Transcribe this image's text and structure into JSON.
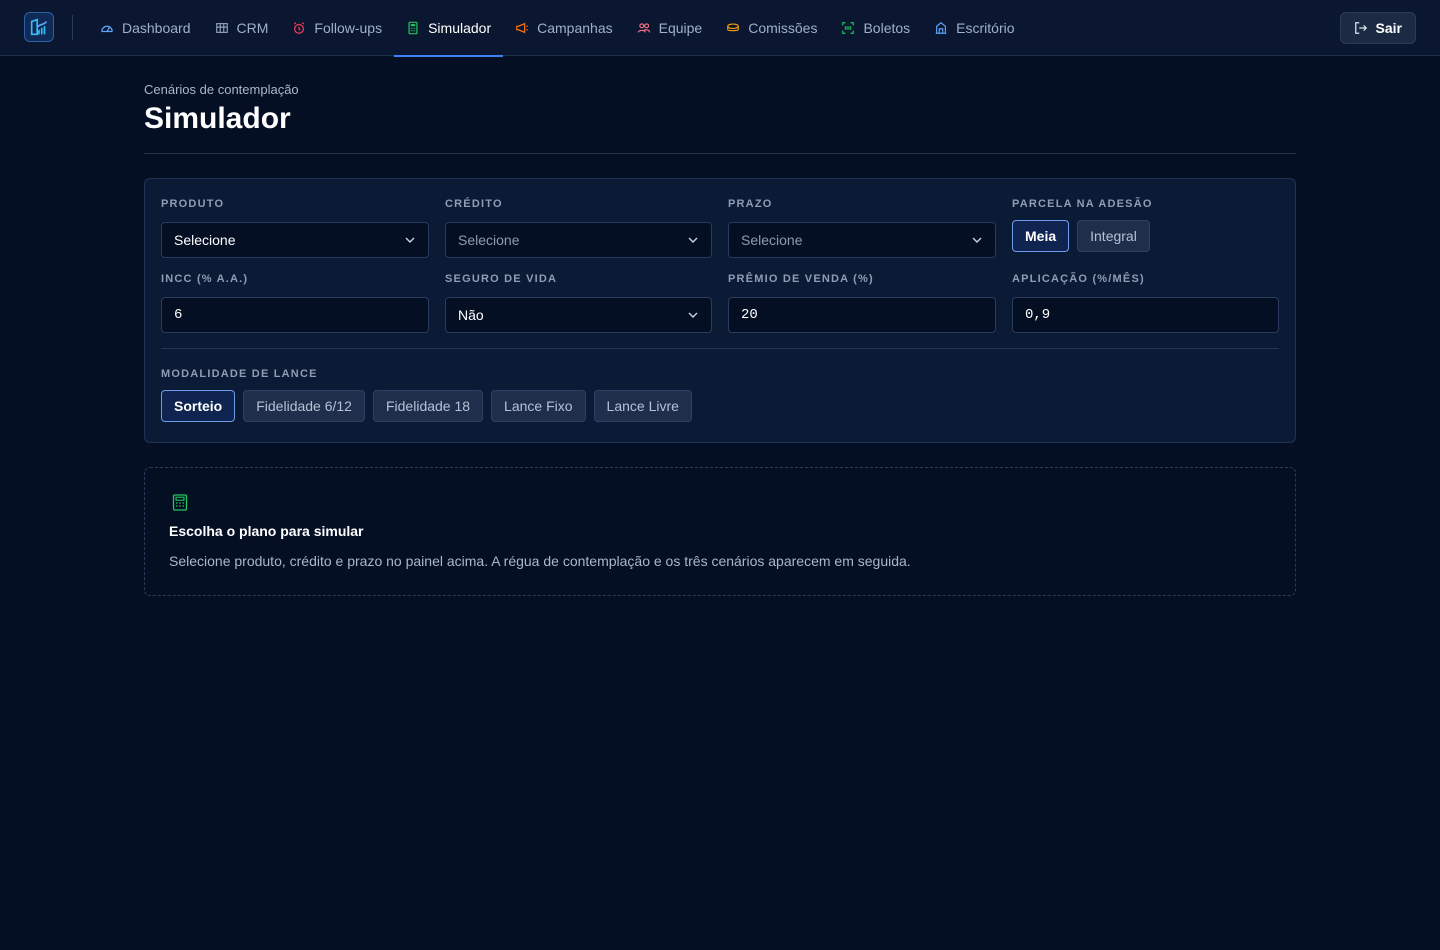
{
  "nav": {
    "items": [
      {
        "label": "Dashboard",
        "icon": "gauge-icon"
      },
      {
        "label": "CRM",
        "icon": "columns-icon"
      },
      {
        "label": "Follow-ups",
        "icon": "alarm-icon"
      },
      {
        "label": "Simulador",
        "icon": "calculator-icon",
        "active": true
      },
      {
        "label": "Campanhas",
        "icon": "megaphone-icon"
      },
      {
        "label": "Equipe",
        "icon": "users-icon"
      },
      {
        "label": "Comissões",
        "icon": "coins-icon"
      },
      {
        "label": "Boletos",
        "icon": "scan-icon"
      },
      {
        "label": "Escritório",
        "icon": "building-icon"
      }
    ],
    "logout_label": "Sair"
  },
  "page": {
    "kicker": "Cenários de contemplação",
    "title": "Simulador"
  },
  "form": {
    "produto": {
      "label": "PRODUTO",
      "value": "Selecione"
    },
    "credito": {
      "label": "CRÉDITO",
      "value": "Selecione"
    },
    "prazo": {
      "label": "PRAZO",
      "value": "Selecione"
    },
    "parcela": {
      "label": "PARCELA NA ADESÃO",
      "options": [
        "Meia",
        "Integral"
      ],
      "selected": "Meia"
    },
    "incc": {
      "label": "INCC (% A.A.)",
      "value": "6"
    },
    "seguro": {
      "label": "SEGURO DE VIDA",
      "value": "Não"
    },
    "premio": {
      "label": "PRÊMIO DE VENDA (%)",
      "value": "20"
    },
    "aplicacao": {
      "label": "APLICAÇÃO (%/MÊS)",
      "value": "0,9"
    },
    "modalidade": {
      "label": "MODALIDADE DE LANCE",
      "options": [
        "Sorteio",
        "Fidelidade 6/12",
        "Fidelidade 18",
        "Lance Fixo",
        "Lance Livre"
      ],
      "selected": "Sorteio"
    }
  },
  "empty_state": {
    "title": "Escolha o plano para simular",
    "text": "Selecione produto, crédito e prazo no painel acima. A régua de contemplação e os três cenários aparecem em seguida."
  },
  "colors": {
    "background": "#050f24",
    "accent": "#3b82f6",
    "panel": "#0b1a35"
  }
}
